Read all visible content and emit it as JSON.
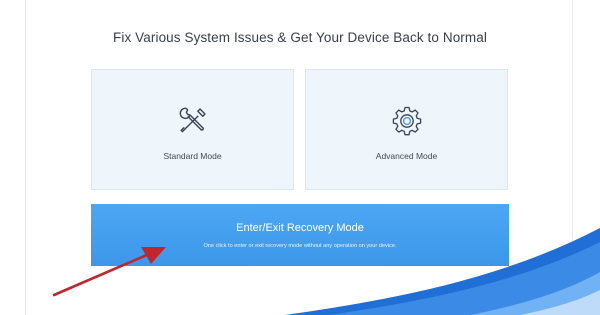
{
  "headline": "Fix Various System Issues & Get Your Device Back to Normal",
  "modes": [
    {
      "label": "Standard Mode",
      "icon": "wrench-screwdriver-icon"
    },
    {
      "label": "Advanced Mode",
      "icon": "gear-icon"
    }
  ],
  "recovery": {
    "title": "Enter/Exit Recovery Mode",
    "subtitle": "One click to enter or exit recovery mode without any operation on your device."
  },
  "colors": {
    "accent": "#3c97ea",
    "card_bg": "#eef5fb",
    "arrow": "#c0272d",
    "wave": "#1a68d0"
  }
}
